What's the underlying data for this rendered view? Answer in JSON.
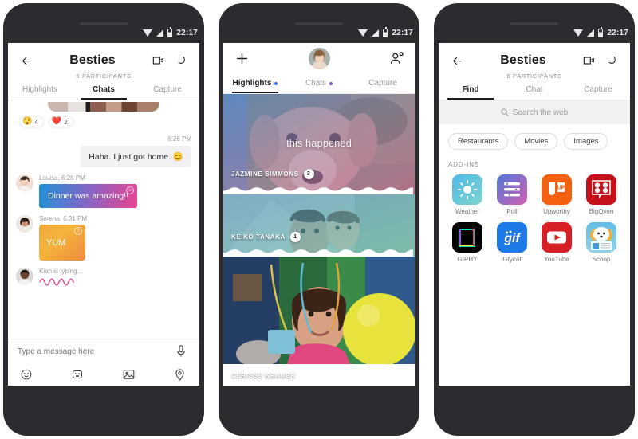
{
  "status_bar": {
    "time": "22:17",
    "icons": [
      "wifi-icon",
      "signal-icon",
      "battery-icon"
    ]
  },
  "phone1": {
    "header": {
      "back": "back-arrow-icon",
      "title": "Besties",
      "subtitle": "6 PARTICIPANTS",
      "video_icon": "video-camera-icon",
      "call_icon": "phone-call-icon"
    },
    "tabs": [
      {
        "label": "Highlights",
        "active": false,
        "dot": null
      },
      {
        "label": "Chats",
        "active": true,
        "dot": null
      },
      {
        "label": "Capture",
        "active": false,
        "dot": null
      }
    ],
    "reactions": [
      {
        "emoji": "😲",
        "count": "4"
      },
      {
        "emoji": "❤️",
        "count": "2"
      }
    ],
    "messages": [
      {
        "kind": "time",
        "text": "6:26 PM"
      },
      {
        "kind": "outgoing",
        "text": "Haha. I just got home. 😊"
      },
      {
        "kind": "incoming_gradient",
        "meta": "Louisa, 6:28 PM",
        "text": "Dinner was amazing!!"
      },
      {
        "kind": "incoming_sticker",
        "meta": "Serena, 6:31 PM",
        "text": "YUM"
      },
      {
        "kind": "typing",
        "meta": "Kian is typing..."
      }
    ],
    "composer": {
      "placeholder": "Type a message here",
      "value": "",
      "mic_icon": "microphone-icon",
      "tools": [
        "emoji-icon",
        "sticker-icon",
        "photo-icon",
        "location-icon"
      ]
    }
  },
  "phone2": {
    "header": {
      "add_icon": "plus-icon",
      "avatar": "profile-avatar",
      "add_person_icon": "add-person-icon"
    },
    "tabs": [
      {
        "label": "Highlights",
        "active": true,
        "dot": "#2f6fe0"
      },
      {
        "label": "Chats",
        "active": false,
        "dot": "#7b4fe0"
      },
      {
        "label": "Capture",
        "active": false,
        "dot": null
      }
    ],
    "cards": [
      {
        "name": "JAZMINE SIMMONS",
        "badge": "3",
        "caption": "this happened"
      },
      {
        "name": "KEIKO TANAKA",
        "badge": "1",
        "caption": ""
      },
      {
        "name": "CERISSE KRAMER",
        "badge": "",
        "caption": ""
      }
    ]
  },
  "phone3": {
    "header": {
      "back": "back-arrow-icon",
      "title": "Besties",
      "subtitle": "6 PARTICIPANTS",
      "video_icon": "video-camera-icon",
      "call_icon": "phone-call-icon"
    },
    "tabs": [
      {
        "label": "Find",
        "active": true
      },
      {
        "label": "Chat",
        "active": false
      },
      {
        "label": "Capture",
        "active": false
      }
    ],
    "search": {
      "placeholder": "Search the web",
      "value": "",
      "icon": "search-icon"
    },
    "chips": [
      "Restaurants",
      "Movies",
      "Images"
    ],
    "section_label": "ADD-INS",
    "addins": [
      {
        "label": "Weather",
        "icon": "weather-sun-icon"
      },
      {
        "label": "Poll",
        "icon": "poll-bars-icon"
      },
      {
        "label": "Upworthy",
        "icon": "upworthy-icon"
      },
      {
        "label": "BigOven",
        "icon": "bigoven-icon"
      },
      {
        "label": "GIPHY",
        "icon": "giphy-icon"
      },
      {
        "label": "Gfycat",
        "icon": "gfycat-icon"
      },
      {
        "label": "YouTube",
        "icon": "youtube-icon"
      },
      {
        "label": "Scoop",
        "icon": "scoop-dog-icon"
      }
    ]
  },
  "colors": {
    "frame": "#2c2c30",
    "accent_blue": "#1f93d8",
    "accent_pink": "#ea4590",
    "sticker_orange": "#f0a93c"
  }
}
